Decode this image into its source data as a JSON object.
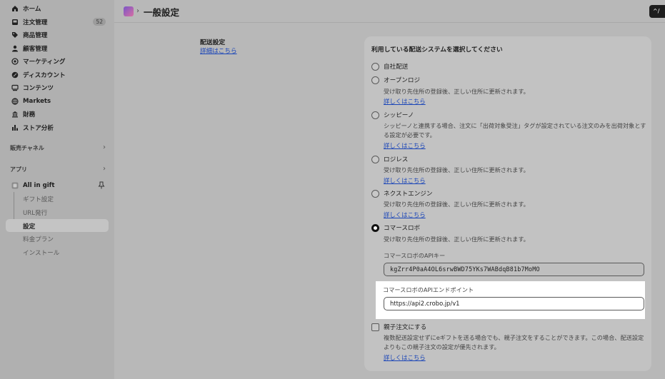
{
  "sidebar": {
    "nav": [
      {
        "label": "ホーム",
        "icon": "home-icon"
      },
      {
        "label": "注文管理",
        "icon": "inbox-icon",
        "badge": "52"
      },
      {
        "label": "商品管理",
        "icon": "tag-icon"
      },
      {
        "label": "顧客管理",
        "icon": "person-icon"
      },
      {
        "label": "マーケティング",
        "icon": "target-icon"
      },
      {
        "label": "ディスカウント",
        "icon": "discount-icon"
      },
      {
        "label": "コンテンツ",
        "icon": "content-icon"
      },
      {
        "label": "Markets",
        "icon": "globe-icon"
      },
      {
        "label": "財務",
        "icon": "bank-icon"
      },
      {
        "label": "ストア分析",
        "icon": "bar-chart-icon"
      }
    ],
    "sales_channels": "販売チャネル",
    "apps": "アプリ",
    "app_name": "All in gift",
    "app_items": [
      "ギフト設定",
      "URL発行",
      "設定",
      "料金プラン",
      "インストール"
    ]
  },
  "header": {
    "title": "一般設定",
    "separator": "›",
    "corner_button": "^/"
  },
  "section": {
    "title": "配送設定",
    "link": "詳細はこちら"
  },
  "card": {
    "title": "利用している配送システムを選択してください",
    "options": [
      {
        "label": "自社配送",
        "checked": false
      },
      {
        "label": "オープンロジ",
        "desc": "受け取り先住所の登録後、正しい住所に更新されます。",
        "link": "詳しくはこちら",
        "checked": false
      },
      {
        "label": "シッピーノ",
        "desc": "シッピーノと連携する場合、注文に「出荷対象受注」タグが設定されている注文のみを出荷対象とする設定が必要です。",
        "link": "詳しくはこちら",
        "checked": false
      },
      {
        "label": "ロジレス",
        "desc": "受け取り先住所の登録後、正しい住所に更新されます。",
        "link": "詳しくはこちら",
        "checked": false
      },
      {
        "label": "ネクストエンジン",
        "desc": "受け取り先住所の登録後、正しい住所に更新されます。",
        "link": "詳しくはこちら",
        "checked": false
      },
      {
        "label": "コマースロボ",
        "desc": "受け取り先住所の登録後、正しい住所に更新されます。",
        "checked": true
      }
    ],
    "api_key_label": "コマースロボのAPIキー",
    "api_key_value": "kgZrr4P0aA4OL6srwBWD75YKs7WABdqB81b7MoMO",
    "api_endpoint_label": "コマースロボのAPIエンドポイント",
    "api_endpoint_value": "https://api2.crobo.jp/v1",
    "parent_child": {
      "label": "親子注文にする",
      "desc": "複数配送設定せずにeギフトを送る場合でも、親子注文をすることができます。この場合、配送設定よりもこの親子注文の設定が優先されます。",
      "link": "詳しくはこちら",
      "checked": false
    }
  },
  "colors": {
    "link": "#1a45b8",
    "highlight": "#ffffff",
    "selected_radio": "#111111"
  }
}
